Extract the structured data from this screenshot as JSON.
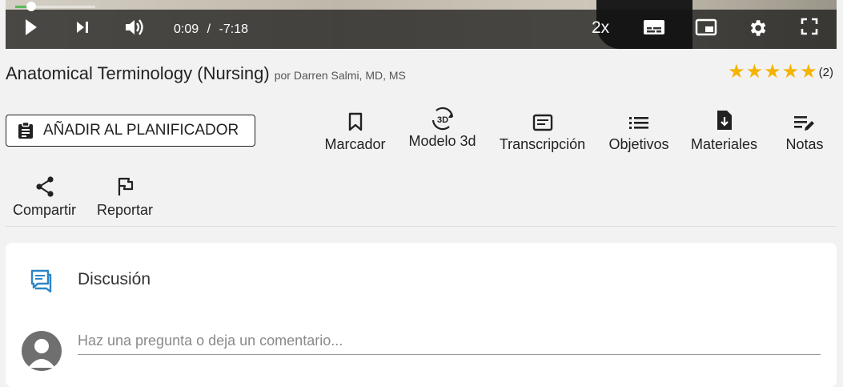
{
  "player": {
    "current_time": "0:09",
    "separator": "/",
    "remaining_time": "-7:18",
    "speed": "2x",
    "progress_fraction": 0.02,
    "accent_color": "#5cb85c"
  },
  "lesson": {
    "title": "Anatomical Terminology (Nursing)",
    "author": "por Darren Salmi, MD, MS",
    "rating_stars": 5,
    "rating_count": "(2)",
    "star_color": "#f5b400"
  },
  "actions": {
    "planner_label": "AÑADIR AL PLANIFICADOR",
    "bookmark": "Marcador",
    "model3d": "Modelo 3d",
    "transcript": "Transcripción",
    "objectives": "Objetivos",
    "materials": "Materiales",
    "notes": "Notas",
    "share": "Compartir",
    "report": "Reportar",
    "badge_3d": "3D"
  },
  "discussion": {
    "title": "Discusión",
    "placeholder": "Haz una pregunta o deja un comentario...",
    "icon_color": "#2b86c5"
  }
}
